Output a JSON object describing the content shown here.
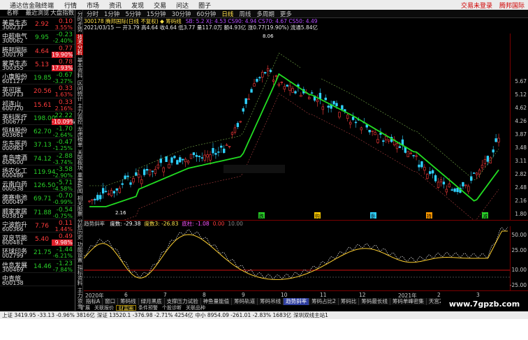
{
  "window": {
    "app_name": "通达信金融终端",
    "menu": [
      "行情",
      "市场",
      "资讯",
      "发现",
      "交易",
      "问达",
      "圈子"
    ],
    "right_menu": [
      "交易未登录",
      "腾邦国际"
    ]
  },
  "stock_list": {
    "headers": [
      "名称",
      "最近浏览",
      "大盘指数"
    ],
    "rows": [
      {
        "name": "美晨生态",
        "code": "300237",
        "price": "2.92",
        "change": "0.10",
        "pct": "3.55%",
        "dir": "up"
      },
      {
        "name": "中超电气",
        "code": "300062",
        "price": "9.95",
        "change": "-0.23",
        "pct": "-2.40%",
        "dir": "dn"
      },
      {
        "name": "腾邦国际",
        "code": "300178",
        "price": "4.64",
        "change": "0.77",
        "pct": "19.90%",
        "dir": "up",
        "selected": true
      },
      {
        "name": "蒙草生态",
        "code": "300355",
        "price": "5.13",
        "change": "0.78",
        "pct": "17.93%",
        "dir": "up",
        "selected": true
      },
      {
        "name": "小康股份",
        "code": "601127",
        "price": "19.85",
        "change": "-0.67",
        "pct": "-3.27%",
        "dir": "dn"
      },
      {
        "name": "英可瑞",
        "code": "300713",
        "price": "20.56",
        "change": "0.33",
        "pct": "1.63%",
        "dir": "up"
      },
      {
        "name": "祁连山",
        "code": "600720",
        "price": "15.61",
        "change": "0.33",
        "pct": "2.16%",
        "dir": "up"
      },
      {
        "name": "英科医疗",
        "code": "300677",
        "price": "198.00",
        "change": "-22.22",
        "pct": "-10.09%",
        "dir": "dn",
        "selected": true
      },
      {
        "name": "恒林股份",
        "code": "603661",
        "price": "62.70",
        "change": "-1.70",
        "pct": "-2.64%",
        "dir": "dn"
      },
      {
        "name": "华东医药",
        "code": "000963",
        "price": "37.13",
        "change": "-0.47",
        "pct": "-1.25%",
        "dir": "dn"
      },
      {
        "name": "青岛啤酒",
        "code": "600600",
        "price": "74.12",
        "change": "-2.88",
        "pct": "-3.74%",
        "dir": "dn"
      },
      {
        "name": "扬农化工",
        "code": "600486",
        "price": "119.94",
        "change": "-3.58",
        "pct": "-2.90%",
        "dir": "dn"
      },
      {
        "name": "云南白药",
        "code": "000538",
        "price": "126.50",
        "change": "-5.71",
        "pct": "-4.58%",
        "dir": "dn"
      },
      {
        "name": "德赛电池",
        "code": "000049",
        "price": "69.71",
        "change": "-0.70",
        "pct": "-0.99%",
        "dir": "dn"
      },
      {
        "name": "顺家家居",
        "code": "603816",
        "price": "71.88",
        "change": "-0.54",
        "pct": "-0.75%",
        "dir": "dn"
      },
      {
        "name": "宁波韵升",
        "code": "600366",
        "price": "7.76",
        "change": "0.11",
        "pct": "1.44%",
        "dir": "up"
      },
      {
        "name": "双良节能",
        "code": "600481",
        "price": "5.40",
        "change": "0.49",
        "pct": "9.98%",
        "dir": "up",
        "selected": true
      },
      {
        "name": "环球印务",
        "code": "002799",
        "price": "21.75",
        "change": "-1.44",
        "pct": "-6.21%",
        "dir": "dn"
      },
      {
        "name": "信息发展",
        "code": "300469",
        "price": "14.46",
        "change": "-1.23",
        "pct": "-7.84%",
        "dir": "dn"
      },
      {
        "name": "中青旅",
        "code": "600138",
        "price": "",
        "change": "",
        "pct": "",
        "dir": "dn"
      }
    ]
  },
  "tool_tabs": [
    "分时走势",
    "技术分析",
    "基本资料",
    "区间统计",
    "主力监控",
    "龙虎榜单",
    "关联板块",
    "重要新闻",
    "相关股票",
    "分析历史",
    "功能设置",
    "指标资料",
    "主力资金"
  ],
  "period_bar": [
    "分时",
    "1分钟",
    "5分钟",
    "15分钟",
    "30分钟",
    "60分钟",
    "日线",
    "周线",
    "多周期",
    "更多"
  ],
  "period_active": "日线",
  "info": {
    "line1": "300178 腾邦国际(日线 不复权)  ◆ 筹码线",
    "line1_ma": "SB: 5.2  XJ: 4.53  CS90: 4.94  CS70: 4.67  CS50: 4.49",
    "line2": "2021/03/15 一  开3.79  高4.64  收4.64  低3.77  量117.0万  额4.93亿  涨0.77(19.90%)  流通5.84亿"
  },
  "price_axis": [
    "5.67",
    "5.12",
    "4.62",
    "4.26",
    "3.87",
    "3.48",
    "3.11",
    "2.82",
    "2.48",
    "2.16",
    "1.80"
  ],
  "chart_labels": {
    "high": "8.06",
    "low": "2.16"
  },
  "signal_labels": [
    "跌",
    "购",
    "卧",
    "持",
    "减"
  ],
  "indicator": {
    "name": "趋势斜率",
    "values": [
      {
        "label": "度数:",
        "value": "-29.38",
        "color": "#ffffff"
      },
      {
        "label": "度数3:",
        "value": "-26.83",
        "color": "#ffe14a"
      },
      {
        "label": "底柱:",
        "value": "-1.08",
        "color": "#ff55ff"
      },
      {
        "label": "",
        "value": "0.00",
        "color": "#ff3c3c"
      },
      {
        "label": "",
        "value": "10.00",
        "color": "#888888"
      }
    ],
    "axis": [
      "50.00",
      "25.00",
      "10.00",
      "-25.00"
    ]
  },
  "time_axis": [
    "2020年",
    "6",
    "7",
    "8",
    "9",
    "10",
    "11",
    "12",
    "2021年",
    "2",
    "3"
  ],
  "tabs1": [
    "指标A",
    "窗口",
    "筹码线",
    "绿月黑底",
    "支撑压力试验",
    "神鱼量能值",
    "筹码轨道",
    "筹码吊线",
    "趋势斜率",
    "筹码占比2",
    "筹码比",
    "筹码最长线",
    "筹码单峰密集",
    "天宫2号",
    "五线",
    "知根知底"
  ],
  "tabs1_active": "趋势斜率",
  "tabs2": [
    "扩展",
    "关联报价",
    "财富圈",
    "条件预警",
    "个股诊断",
    "关联品种"
  ],
  "tabs2_active": "财富圈",
  "status": [
    "上证 3419.95 -33.13 -0.96% 3816亿",
    "深证 13520.1 -376.98 -2.71% 4254亿",
    "中小 8954.09 -261.01 -2.83% 1683亿",
    "深圳双线主站1"
  ],
  "watermark": "www.7gpzb.com",
  "colors": {
    "up": "#ff3c3c",
    "down": "#29d029",
    "ma": "#22dd22",
    "sel": "#e0202b"
  }
}
